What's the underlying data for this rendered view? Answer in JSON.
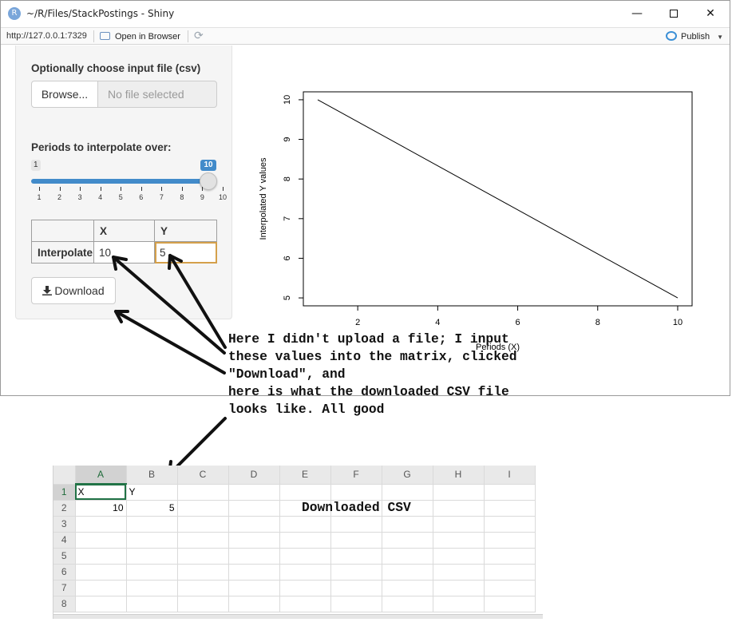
{
  "window": {
    "app_icon": "R",
    "title": "~/R/Files/StackPostings - Shiny",
    "url": "http://127.0.0.1:7329",
    "open_in_browser": "Open in Browser",
    "publish": "Publish",
    "icons": [
      "r-logo-icon",
      "minimize-icon",
      "maximize-icon",
      "close-icon",
      "open-in-browser-icon",
      "refresh-icon",
      "publish-icon",
      "chevron-down-icon",
      "download-icon"
    ]
  },
  "sidebar": {
    "file_label": "Optionally choose input file (csv)",
    "browse_label": "Browse...",
    "file_placeholder": "No file selected",
    "slider_label": "Periods to interpolate over:",
    "slider_min": "1",
    "slider_max": "10",
    "slider_value": "10",
    "slider_ticks": [
      "1",
      "2",
      "3",
      "4",
      "5",
      "6",
      "7",
      "8",
      "9",
      "10"
    ],
    "matrix": {
      "col_headers": [
        "X",
        "Y"
      ],
      "row_label": "Interpolate",
      "x_value": "10",
      "y_value": "5"
    },
    "download_label": "Download",
    "accent_color": "#428bca"
  },
  "chart_data": {
    "type": "line",
    "x": [
      1,
      10
    ],
    "y": [
      10,
      5
    ],
    "xlabel": "Periods (X)",
    "ylabel": "Interpolated Y values",
    "xticks": [
      "2",
      "4",
      "6",
      "8",
      "10"
    ],
    "yticks": [
      "5",
      "6",
      "7",
      "8",
      "9",
      "10"
    ],
    "xlim": [
      0.64,
      10.36
    ],
    "ylim": [
      4.8,
      10.2
    ],
    "grid": false
  },
  "annotation": {
    "text": "Here I didn't upload a file; I input\nthese values into the matrix, clicked\n\"Download\", and\nhere is what the downloaded CSV file\nlooks like. All good"
  },
  "spreadsheet": {
    "columns": [
      "A",
      "B",
      "C",
      "D",
      "E",
      "F",
      "G",
      "H",
      "I"
    ],
    "rows": [
      "1",
      "2",
      "3",
      "4",
      "5",
      "6",
      "7",
      "8"
    ],
    "cells": {
      "A1": "X",
      "B1": "Y",
      "A2": "10",
      "B2": "5"
    },
    "note": "Downloaded CSV",
    "accent_color": "#217346"
  }
}
